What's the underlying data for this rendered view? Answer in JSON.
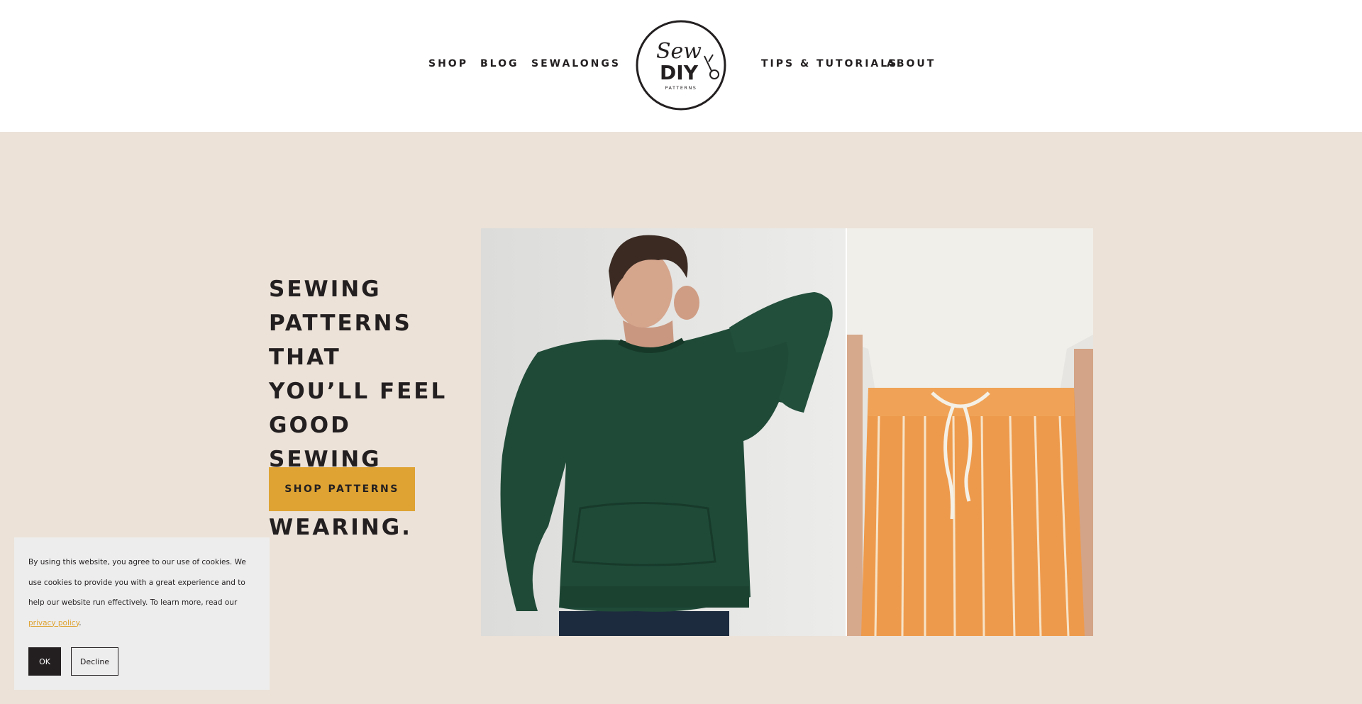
{
  "nav": {
    "left": [
      "SHOP",
      "BLOG",
      "SEWALONGS"
    ],
    "right": [
      "TIPS & TUTORIALS",
      "ABOUT"
    ]
  },
  "logo": {
    "line1": "Sew",
    "line2": "DIY",
    "line3": "PATTERNS"
  },
  "hero": {
    "headline_lines": [
      "SEWING",
      "PATTERNS THAT",
      "YOU’LL FEEL",
      "GOOD SEWING",
      "AND WEARING."
    ],
    "cta_label": "SHOP PATTERNS"
  },
  "cookie": {
    "text": "By using this website, you agree to our use of cookies. We use cookies to provide you with a great experience and to help our website run effectively. To learn more, read our ",
    "link_text": "privacy policy",
    "trailing": ".",
    "ok_label": "OK",
    "decline_label": "Decline"
  },
  "colors": {
    "accent": "#dea333",
    "hero_bg": "#ece2d8",
    "text": "#231f20",
    "sweater": "#1f4a38",
    "skirt": "#ee9a4c"
  }
}
